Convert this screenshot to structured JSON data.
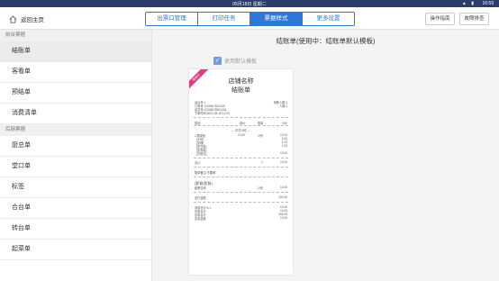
{
  "status": {
    "date": "05月18日 星期二",
    "time": "16:59"
  },
  "topbar": {
    "home_label": "返回主页",
    "tabs": [
      {
        "label": "出票口管理"
      },
      {
        "label": "打印任务"
      },
      {
        "label": "票据样式"
      },
      {
        "label": "更多设置"
      }
    ],
    "help_button": "操作指南",
    "report_button": "故障排查"
  },
  "sidebar": {
    "front_section": "前台票据",
    "front_items": [
      {
        "label": "结账单"
      },
      {
        "label": "客看单"
      },
      {
        "label": "预结单"
      },
      {
        "label": "消费清单"
      }
    ],
    "back_section": "后厨票据",
    "back_items": [
      {
        "label": "厨总单"
      },
      {
        "label": "堂口单"
      },
      {
        "label": "标签"
      },
      {
        "label": "合台单"
      },
      {
        "label": "转台单"
      },
      {
        "label": "起菜单"
      }
    ]
  },
  "main": {
    "title": "结账单(使用中：结账单默认模板)",
    "checkbox_label": "使用默认模板"
  },
  "receipt": {
    "ribbon": "使用中",
    "shop_name": "店铺名称",
    "receipt_title": "结账单",
    "info_left": [
      "桌台号:1",
      "订单号:1234567812345",
      "会员号:12345678901234",
      "下单时间:2021-05-18 12:00"
    ],
    "info_right": [
      "用餐人数:3",
      "人数:2"
    ],
    "col_headers": {
      "name": "菜品",
      "price": "单价",
      "qty": "数量",
      "amount": "小计"
    },
    "category": "--- 中式小吃 ---",
    "dishes": [
      {
        "name": "1.酸菜鱼",
        "price": "10.00",
        "qty": "1/份",
        "amount": "10.00"
      },
      {
        "name": "[大份]",
        "price": "",
        "qty": "",
        "amount": "2.00"
      },
      {
        "name": "[加辣]",
        "price": "",
        "qty": "",
        "amount": "1.00"
      },
      {
        "name": "[加豆腐]",
        "price": "",
        "qty": "",
        "amount": "1.00"
      },
      {
        "name": "[加香菜]",
        "price": "",
        "qty": "",
        "amount": ""
      },
      {
        "name": "[去葱花]",
        "price": "",
        "qty": "",
        "amount": "10.00"
      }
    ],
    "total_label": "合计",
    "total_qty": "1",
    "total_amount": "10.00",
    "remark": "整单备注:不要辣",
    "package_name": "[套餐]套餐1",
    "package_item": "套餐名称",
    "package_qty": "1/份",
    "package_amount": "10.00",
    "subtotal_label": "应付金额",
    "subtotal_amount": "100.00",
    "summary": [
      {
        "label": "消费总计:0.1",
        "value": "10.00"
      },
      {
        "label": "优惠合计",
        "value": "10.00"
      },
      {
        "label": "应收合计",
        "value": "200.00"
      },
      {
        "label": "实收金额",
        "value": "10.00"
      }
    ]
  }
}
